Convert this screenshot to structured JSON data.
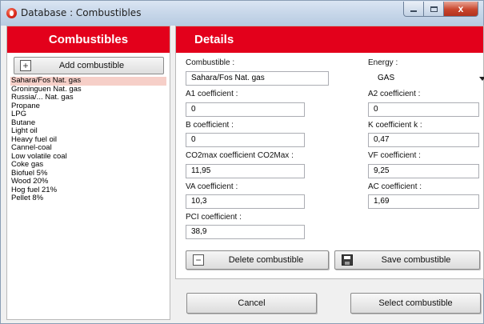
{
  "window": {
    "title": "Database : Combustibles",
    "close_glyph": "x"
  },
  "left_panel": {
    "title": "Combustibles",
    "add_button": {
      "label": "Add combustible",
      "icon": "plus-icon"
    },
    "items": [
      "Sahara/Fos Nat. gas",
      "Groninguen Nat. gas",
      "Russia/... Nat. gas",
      "Propane",
      "LPG",
      "Butane",
      "Light oil",
      "Heavy fuel oil",
      "Cannel-coal",
      "Low volatile coal",
      "Coke gas",
      "Biofuel 5%",
      "Wood 20%",
      "Hog fuel 21%",
      "Pellet 8%"
    ],
    "selected_index": 0
  },
  "details": {
    "title": "Details",
    "combustible_label": "Combustible :",
    "combustible_value": "Sahara/Fos Nat. gas",
    "energy_label": "Energy :",
    "energy_value": "GAS",
    "a1_label": "A1 coefficient  :",
    "a1_value": "0",
    "a2_label": "A2 coefficient :",
    "a2_value": "0",
    "b_label": "B coefficient  :",
    "b_value": "0",
    "k_label": "K coefficient k :",
    "k_value": "0,47",
    "co2_label": "CO2max coefficient CO2Max :",
    "co2_value": "11,95",
    "vf_label": "VF coefficient :",
    "vf_value": "9,25",
    "va_label": "VA  coefficient  :",
    "va_value": "10,3",
    "ac_label": "AC coefficient :",
    "ac_value": "1,69",
    "pci_label": "PCI  coefficient  :",
    "pci_value": "38,9",
    "delete_button": "Delete combustible",
    "save_button": "Save combustible"
  },
  "footer": {
    "cancel": "Cancel",
    "select": "Select combustible"
  },
  "colors": {
    "header_red": "#e3001b",
    "selection": "#f6cfc8"
  }
}
